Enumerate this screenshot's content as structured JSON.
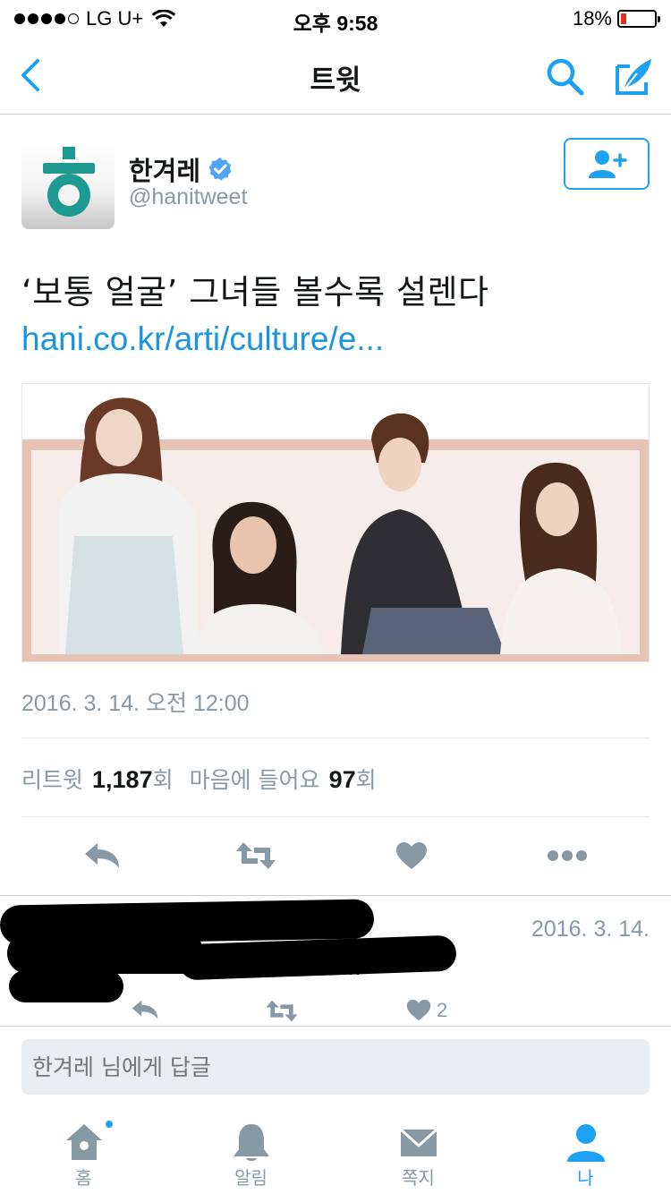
{
  "status_bar": {
    "carrier": "LG U+",
    "time": "오후 9:58",
    "battery": "18%",
    "battery_level": 0.18
  },
  "nav": {
    "title": "트윗"
  },
  "tweet": {
    "author_name": "한겨레",
    "author_handle": "@hanitweet",
    "verified": true,
    "text": "‘보통 얼굴’ 그녀들 볼수록 설렌다",
    "link": "hani.co.kr/arti/culture/e...",
    "timestamp": "2016. 3. 14. 오전 12:00",
    "stats": {
      "retweet_label": "리트윗",
      "retweet_count": "1,187",
      "count_suffix": "회",
      "like_label": "마음에 들어요",
      "like_count": "97"
    }
  },
  "reply": {
    "date": "2016. 3. 14.",
    "text_visible": "...",
    "like_count": "2"
  },
  "reply_bar": {
    "placeholder": "한겨레 님에게 답글"
  },
  "tabs": [
    {
      "label": "홈",
      "icon": "home-icon"
    },
    {
      "label": "알림",
      "icon": "bell-icon"
    },
    {
      "label": "쪽지",
      "icon": "envelope-icon"
    },
    {
      "label": "나",
      "icon": "person-icon"
    }
  ],
  "colors": {
    "accent": "#1da1f2",
    "link": "#1b95e0",
    "muted": "#8899a6",
    "icon_gray": "#8899a6"
  }
}
